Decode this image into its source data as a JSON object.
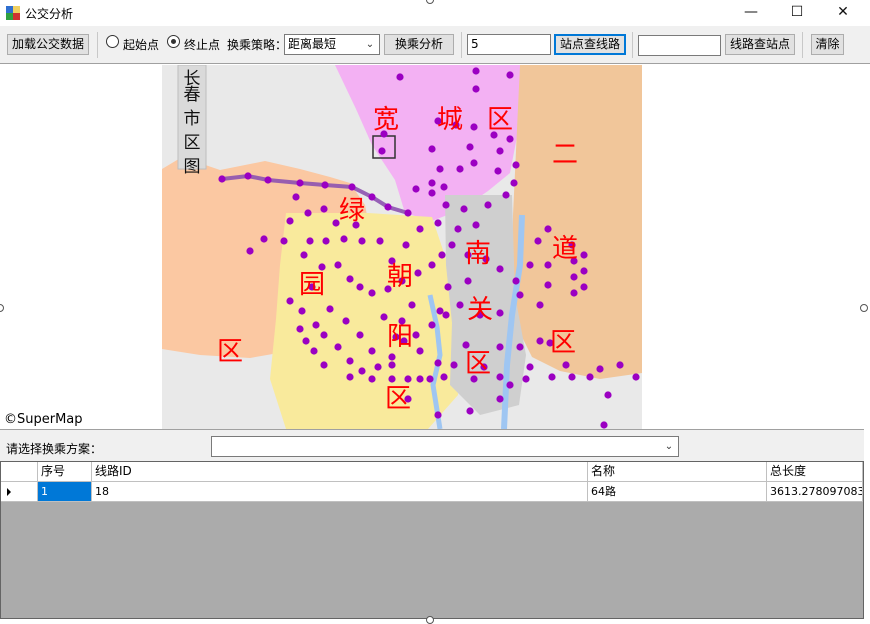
{
  "window": {
    "title": "公交分析",
    "minimize_glyph": "—",
    "maximize_glyph": "☐",
    "close_glyph": "✕"
  },
  "toolbar": {
    "load_button": "加载公交数据",
    "start_point_label": "起始点",
    "end_point_label": "终止点",
    "selected_point_mode": "终止点",
    "strategy_label": "换乘策略：",
    "strategy_value": "距离最短",
    "transfer_analysis_button": "换乘分析",
    "stop_query_input_value": "5",
    "stop_query_button": "站点查线路",
    "route_query_input_value": "",
    "route_query_button": "线路查站点",
    "clear_button": "清除"
  },
  "map": {
    "labels": [
      "长",
      "春",
      "市",
      "区",
      "图",
      "宽",
      "城",
      "区",
      "二",
      "绿",
      "道",
      "园",
      "朝",
      "南",
      "关",
      "区",
      "阳",
      "区",
      "区",
      "区"
    ],
    "copyright": "©SuperMap",
    "colors": {
      "background": "#e9e9e9",
      "kuancheng": "#f3b1f3",
      "erdao": "#f1c69a",
      "lvyuan": "#fbc8a2",
      "chaoyang": "#f9ea9c",
      "nanguan": "#cfcfcf",
      "stop": "#9b00c2",
      "route": "#8d52b0",
      "label": "#ff0000"
    }
  },
  "plan_selector": {
    "label": "请选择换乘方案：",
    "value": ""
  },
  "results_table": {
    "columns": [
      "序号",
      "线路ID",
      "名称",
      "总长度"
    ],
    "rows": [
      {
        "index": "1",
        "route_id": "18",
        "name": "64路",
        "length": "3613.278097083"
      }
    ]
  }
}
